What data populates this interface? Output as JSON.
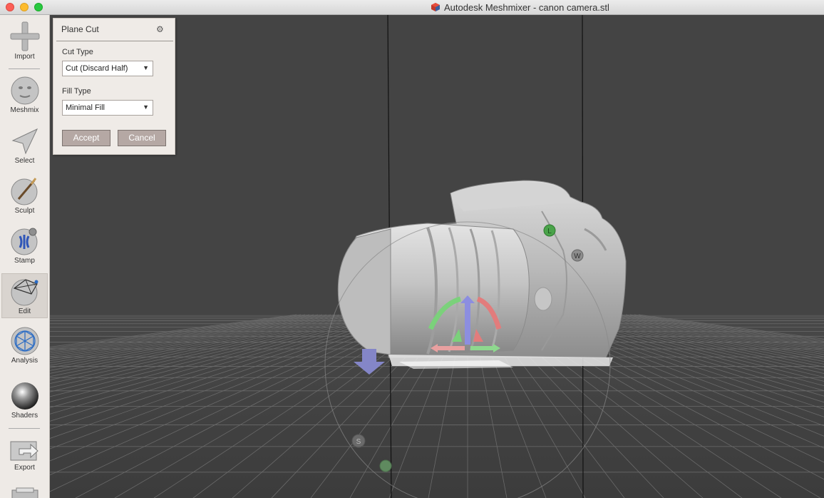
{
  "window": {
    "title": "Autodesk Meshmixer - canon camera.stl"
  },
  "toolbar": {
    "items": [
      {
        "label": "Import",
        "icon": "plus-icon"
      },
      {
        "label": "Meshmix",
        "icon": "meshmix-face-icon"
      },
      {
        "label": "Select",
        "icon": "cursor-arrow-icon"
      },
      {
        "label": "Sculpt",
        "icon": "brush-icon"
      },
      {
        "label": "Stamp",
        "icon": "stamp-icon"
      },
      {
        "label": "Edit",
        "icon": "edit-mesh-icon",
        "active": true
      },
      {
        "label": "Analysis",
        "icon": "analysis-mesh-icon"
      },
      {
        "label": "Shaders",
        "icon": "shader-sphere-icon"
      },
      {
        "label": "Export",
        "icon": "export-icon"
      }
    ]
  },
  "panel": {
    "title": "Plane Cut",
    "cut_type": {
      "label": "Cut Type",
      "value": "Cut (Discard Half)"
    },
    "fill_type": {
      "label": "Fill Type",
      "value": "Minimal Fill"
    },
    "accept_label": "Accept",
    "cancel_label": "Cancel"
  },
  "gizmo": {
    "markers": [
      "L",
      "W",
      "S"
    ]
  },
  "colors": {
    "viewport_bg": "#444444",
    "grid_line": "#6a6a6a",
    "toolbar_bg": "#eeeae6",
    "button_bg": "#b5a8a4"
  }
}
